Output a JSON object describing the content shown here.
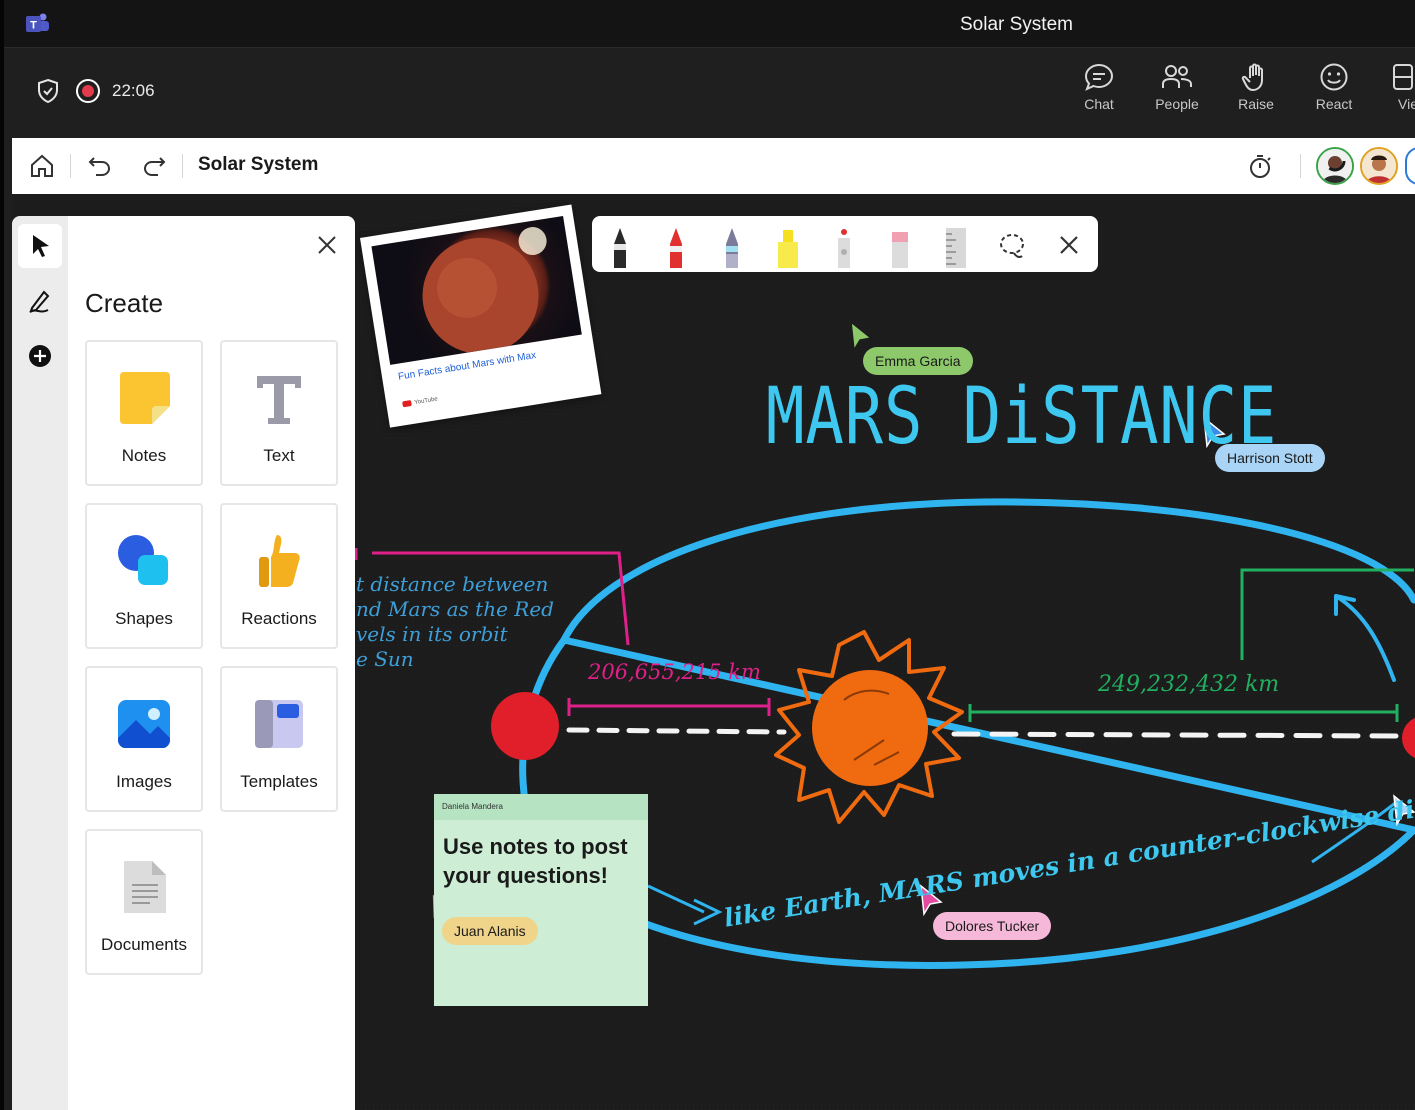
{
  "window": {
    "title": "Solar System"
  },
  "meeting": {
    "timer": "22:06",
    "buttons": [
      {
        "label": "Chat",
        "icon": "chat-icon"
      },
      {
        "label": "People",
        "icon": "people-icon"
      },
      {
        "label": "Raise",
        "icon": "hand-icon"
      },
      {
        "label": "React",
        "icon": "smile-icon"
      },
      {
        "label": "View",
        "icon": "view-icon"
      }
    ]
  },
  "toolbar": {
    "board_title": "Solar System"
  },
  "create_panel": {
    "title": "Create",
    "tiles": [
      {
        "label": "Notes",
        "icon": "sticky-note-icon"
      },
      {
        "label": "Text",
        "icon": "text-icon"
      },
      {
        "label": "Shapes",
        "icon": "shapes-icon"
      },
      {
        "label": "Reactions",
        "icon": "thumbs-up-icon"
      },
      {
        "label": "Images",
        "icon": "image-icon"
      },
      {
        "label": "Templates",
        "icon": "templates-icon"
      },
      {
        "label": "Documents",
        "icon": "document-icon"
      }
    ]
  },
  "pen_toolbar": {
    "tools": [
      "black-pen",
      "red-pen",
      "rainbow-pen",
      "yellow-highlighter",
      "laser-pointer",
      "eraser",
      "ruler",
      "lasso-select"
    ],
    "colors": {
      "black": "#222222",
      "red": "#e03030",
      "yellow": "#f5e020"
    }
  },
  "canvas": {
    "headline": "MARS DiSTANCE",
    "photo_card": {
      "caption": "Fun Facts about Mars with Max",
      "source": "YouTube"
    },
    "annotation_lines": [
      "t distance between",
      "nd Mars as the Red",
      "vels in its orbit",
      "e Sun"
    ],
    "distance_left": "206,655,215 km",
    "distance_right": "249,232,432  km",
    "orbit_text": "like Earth, MARS moves in a counter-clockwise direction",
    "colors": {
      "orbit": "#2fb4f0",
      "magenta": "#e0208a",
      "green": "#20b060",
      "sun": "#f06a10",
      "mars": "#e01f2a"
    },
    "cursors": [
      {
        "name": "Emma Garcia",
        "color": "#8dc86a"
      },
      {
        "name": "Harrison Stott",
        "color": "#a9d4f5"
      },
      {
        "name": "Dolores Tucker",
        "color": "#f5b8d8"
      },
      {
        "name": "Juan Alanis",
        "color": "#f0d48a"
      }
    ],
    "note": {
      "author": "Daniela Mandera",
      "text": "Use notes to post your questions!"
    }
  }
}
